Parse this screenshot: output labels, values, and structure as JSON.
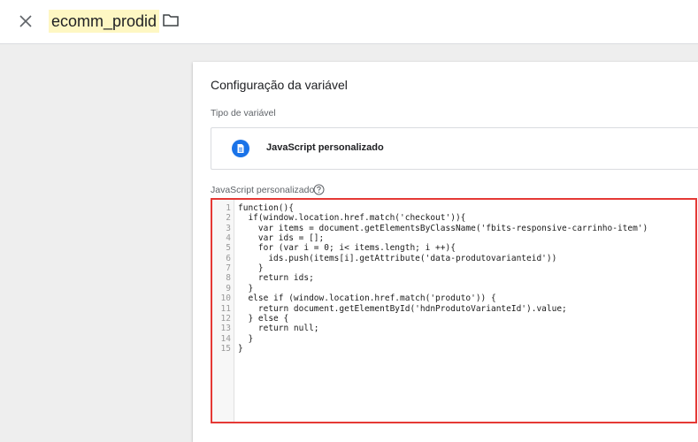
{
  "header": {
    "variable_name": "ecomm_prodid"
  },
  "card": {
    "title": "Configuração da variável",
    "type_label": "Tipo de variável",
    "type_value": "JavaScript personalizado",
    "code_label": "JavaScript personalizado"
  },
  "code": {
    "line_numbers": [
      "1",
      "2",
      "3",
      "4",
      "5",
      "6",
      "7",
      "8",
      "9",
      "10",
      "11",
      "12",
      "13",
      "14",
      "15"
    ],
    "lines": [
      "function(){",
      "  if(window.location.href.match('checkout')){",
      "    var items = document.getElementsByClassName('fbits-responsive-carrinho-item')",
      "    var ids = [];",
      "    for (var i = 0; i< items.length; i ++){",
      "      ids.push(items[i].getAttribute('data-produtovarianteid'))",
      "    }",
      "    return ids;",
      "  }",
      "  else if (window.location.href.match('produto')) {",
      "    return document.getElementById('hdnProdutoVarianteId').value;",
      "  } else {",
      "    return null;",
      "  }",
      "}"
    ]
  },
  "colors": {
    "accent": "#1a73e8",
    "highlight_border": "#e53935",
    "name_highlight": "#fef7c3"
  },
  "icons": {
    "close": "close-icon",
    "folder": "folder-icon",
    "type": "document-icon",
    "help": "help-icon"
  }
}
